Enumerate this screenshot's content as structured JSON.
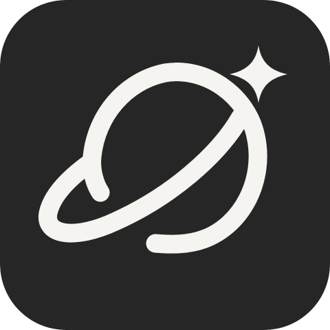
{
  "icon": {
    "name": "planet-with-sparkle-logo",
    "colors": {
      "background": "#262626",
      "foreground": "#f6f4f0"
    }
  }
}
